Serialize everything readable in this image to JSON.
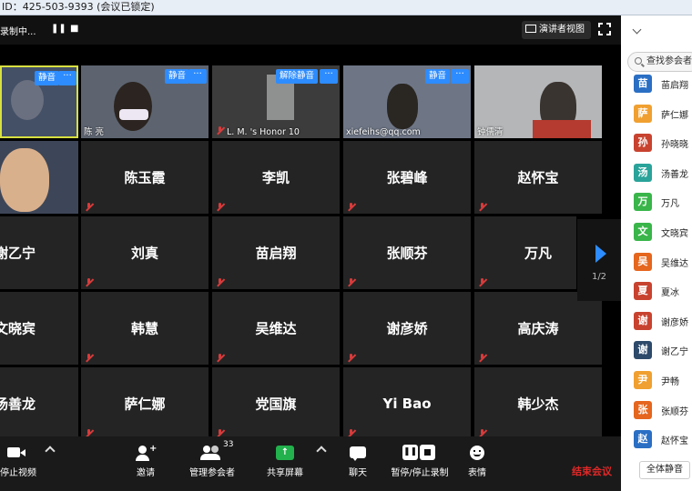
{
  "titlebar": {
    "text": "ID：425-503-9393   (会议已锁定)"
  },
  "topbar": {
    "recording": "录制中...",
    "speaker_view": "演讲者视图"
  },
  "video_tiles": [
    {
      "badge": "静音",
      "label": ""
    },
    {
      "badge": "静音",
      "label": "陈 亮"
    },
    {
      "badge": "解除静音",
      "label": "L. M. 's Honor 10"
    },
    {
      "badge": "静音",
      "label": "xiefeihs@qq.com"
    },
    {
      "badge": "",
      "label": "钟儒清"
    },
    {
      "badge": "",
      "label": ""
    }
  ],
  "name_tiles": [
    "陈玉霞",
    "李凯",
    "张碧峰",
    "赵怀宝",
    "谢乙宁",
    "刘真",
    "苗启翔",
    "张顺芬",
    "万凡",
    "文晓宾",
    "韩慧",
    "吴维达",
    "谢彦娇",
    "高庆涛",
    "汤善龙",
    "萨仁娜",
    "党国旗",
    "Yi Bao",
    "韩少杰"
  ],
  "pager": {
    "page": "1/2"
  },
  "toolbar": {
    "stop_video": "停止视频",
    "invite": "邀请",
    "manage_participants": "管理参会者",
    "participant_count": "33",
    "share_screen": "共享屏幕",
    "chat": "聊天",
    "pause_stop_recording": "暂停/停止录制",
    "reactions": "表情",
    "end_meeting": "结束会议"
  },
  "sidebar": {
    "search_placeholder": "查找参会者",
    "participants": [
      {
        "avatar": "苗",
        "name": "苗启翔",
        "color": "#2a6fc4"
      },
      {
        "avatar": "萨",
        "name": "萨仁娜",
        "color": "#f0a030"
      },
      {
        "avatar": "孙",
        "name": "孙晓晓",
        "color": "#c8432f"
      },
      {
        "avatar": "汤",
        "name": "汤善龙",
        "color": "#2aa39a"
      },
      {
        "avatar": "万",
        "name": "万凡",
        "color": "#39b54a"
      },
      {
        "avatar": "文",
        "name": "文晓宾",
        "color": "#39b54a"
      },
      {
        "avatar": "吴",
        "name": "吴维达",
        "color": "#e5661e"
      },
      {
        "avatar": "夏",
        "name": "夏冰",
        "color": "#c8432f"
      },
      {
        "avatar": "谢",
        "name": "谢彦娇",
        "color": "#c8432f"
      },
      {
        "avatar": "谢",
        "name": "谢乙宁",
        "color": "#2e4a6b"
      },
      {
        "avatar": "尹",
        "name": "尹畅",
        "color": "#f0a030"
      },
      {
        "avatar": "张",
        "name": "张顺芬",
        "color": "#e5661e"
      },
      {
        "avatar": "赵",
        "name": "赵怀宝",
        "color": "#2a6fc4"
      }
    ],
    "mute_all": "全体静音"
  }
}
